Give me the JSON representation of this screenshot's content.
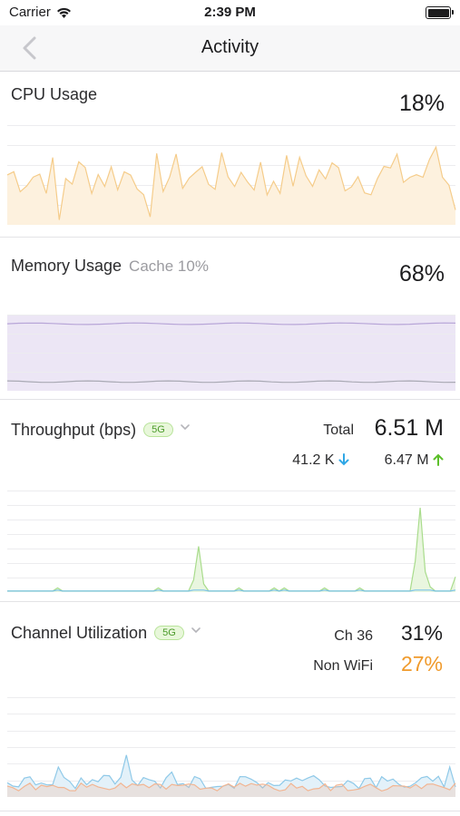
{
  "status": {
    "carrier": "Carrier",
    "time": "2:39 PM"
  },
  "nav": {
    "title": "Activity"
  },
  "cpu": {
    "label": "CPU Usage",
    "value": "18%"
  },
  "memory": {
    "label": "Memory Usage",
    "cache": "Cache 10%",
    "value": "68%"
  },
  "throughput": {
    "label": "Throughput (bps)",
    "band": "5G",
    "total_label": "Total",
    "total": "6.51 M",
    "down": "41.2 K",
    "up": "6.47 M"
  },
  "channel": {
    "label": "Channel Utilization",
    "band": "5G",
    "ch_label": "Ch 36",
    "ch_value": "31%",
    "nonwifi_label": "Non WiFi",
    "nonwifi_value": "27%"
  },
  "colors": {
    "cpu_line": "#f5cc8a",
    "cpu_fill": "#fdf1de",
    "mem_line": "#b8a6d8",
    "mem_fill": "#ece6f5",
    "tp_line": "#a9dc8c",
    "tp_fill": "#e9f6df",
    "ch_line": "#8fc9e8",
    "ch_fill": "#e3f1f9",
    "ch_line2": "#f2b592",
    "down_arrow": "#2fa7e6",
    "up_arrow": "#5cbf2a",
    "nonwifi": "#f09a2b"
  }
}
